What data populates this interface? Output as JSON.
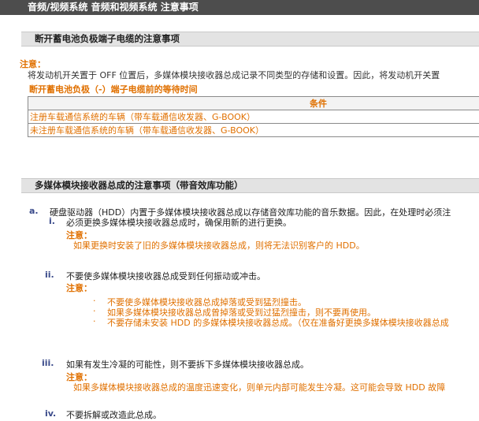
{
  "title": "音频/视频系统  音频和视频系统  注意事项",
  "section1": {
    "heading": "断开蓄电池负极端子电缆的注意事项",
    "note_label": "注意：",
    "note_text": "将发动机开关置于 OFF 位置后，多媒体模块接收器总成记录不同类型的存储和设置。因此，将发动机开关置",
    "sub_heading": "断开蓄电池负极（-）端子电缆前的等待时间",
    "table": {
      "header": "条件",
      "rows": [
        "注册车载通信系统的车辆（带车载通信收发器、G-BOOK）",
        "未注册车载通信系统的车辆（带车载通信收发器、G-BOOK）"
      ]
    }
  },
  "section2": {
    "heading": "多媒体模块接收器总成的注意事项（带音效库功能）",
    "item_a": {
      "marker": "a.",
      "text": "硬盘驱动器（HDD）内置于多媒体模块接收器总成以存储音效库功能的音乐数据。因此，在处理时必须注"
    },
    "item_i": {
      "marker": "i.",
      "text": "必须更换多媒体模块接收器总成时，确保用新的进行更换。",
      "note_label": "注意：",
      "note_text": "如果更换时安装了旧的多媒体模块接收器总成，则将无法识别客户的 HDD。"
    },
    "item_ii": {
      "marker": "ii.",
      "text": "不要使多媒体模块接收器总成受到任何振动或冲击。",
      "note_label": "注意：",
      "bullets": [
        "不要使多媒体模块接收器总成掉落或受到猛烈撞击。",
        "如果多媒体模块接收器总成曾掉落或受到过猛烈撞击，则不要再使用。",
        "不要存储未安装 HDD 的多媒体模块接收器总成。（仅在准备好更换多媒体模块接收器总成"
      ]
    },
    "item_iii": {
      "marker": "iii.",
      "text": "如果有发生冷凝的可能性，则不要拆下多媒体模块接收器总成。",
      "note_label": "注意：",
      "note_text": "如果多媒体模块接收器总成的温度迅速变化，则单元内部可能发生冷凝。这可能会导致 HDD 故障"
    },
    "item_iv": {
      "marker": "iv.",
      "text": "不要拆解或改造此总成。"
    }
  }
}
